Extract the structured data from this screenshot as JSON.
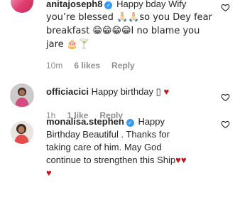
{
  "comments": [
    {
      "username": "anitajoseph8",
      "verified": true,
      "text_line1": "Happy bday Wify",
      "text_line2": "you’re blessed 🙏🏻🙏🏻so you Dey fear",
      "text_line3": "breakfast 😁😁😁😁I no blame you",
      "text_line4": "jare 🎂🍸",
      "time": "10m",
      "likes": "6 likes",
      "reply": "Reply"
    },
    {
      "username": "officiacici",
      "verified": false,
      "text": "Happy birthday ▯",
      "heart": "♥",
      "time": "1h",
      "likes": "1 like",
      "reply": "Reply"
    },
    {
      "username": "monalisa.stephen",
      "verified": true,
      "text_line1": "Happy",
      "text_line2": "Birthday Beautiful . Thanks for",
      "text_line3": "taking care of him. May God",
      "text_line4": "continue to strengthen this Ship",
      "hearts_inline": "♥♥",
      "heart_line5": "♥"
    }
  ],
  "icons": {
    "verified": "✓",
    "like": "heart-outline-icon"
  },
  "colors": {
    "text": "#262626",
    "meta": "#8e8e8e",
    "verified": "#3897f0",
    "heart": "#c0161d"
  }
}
